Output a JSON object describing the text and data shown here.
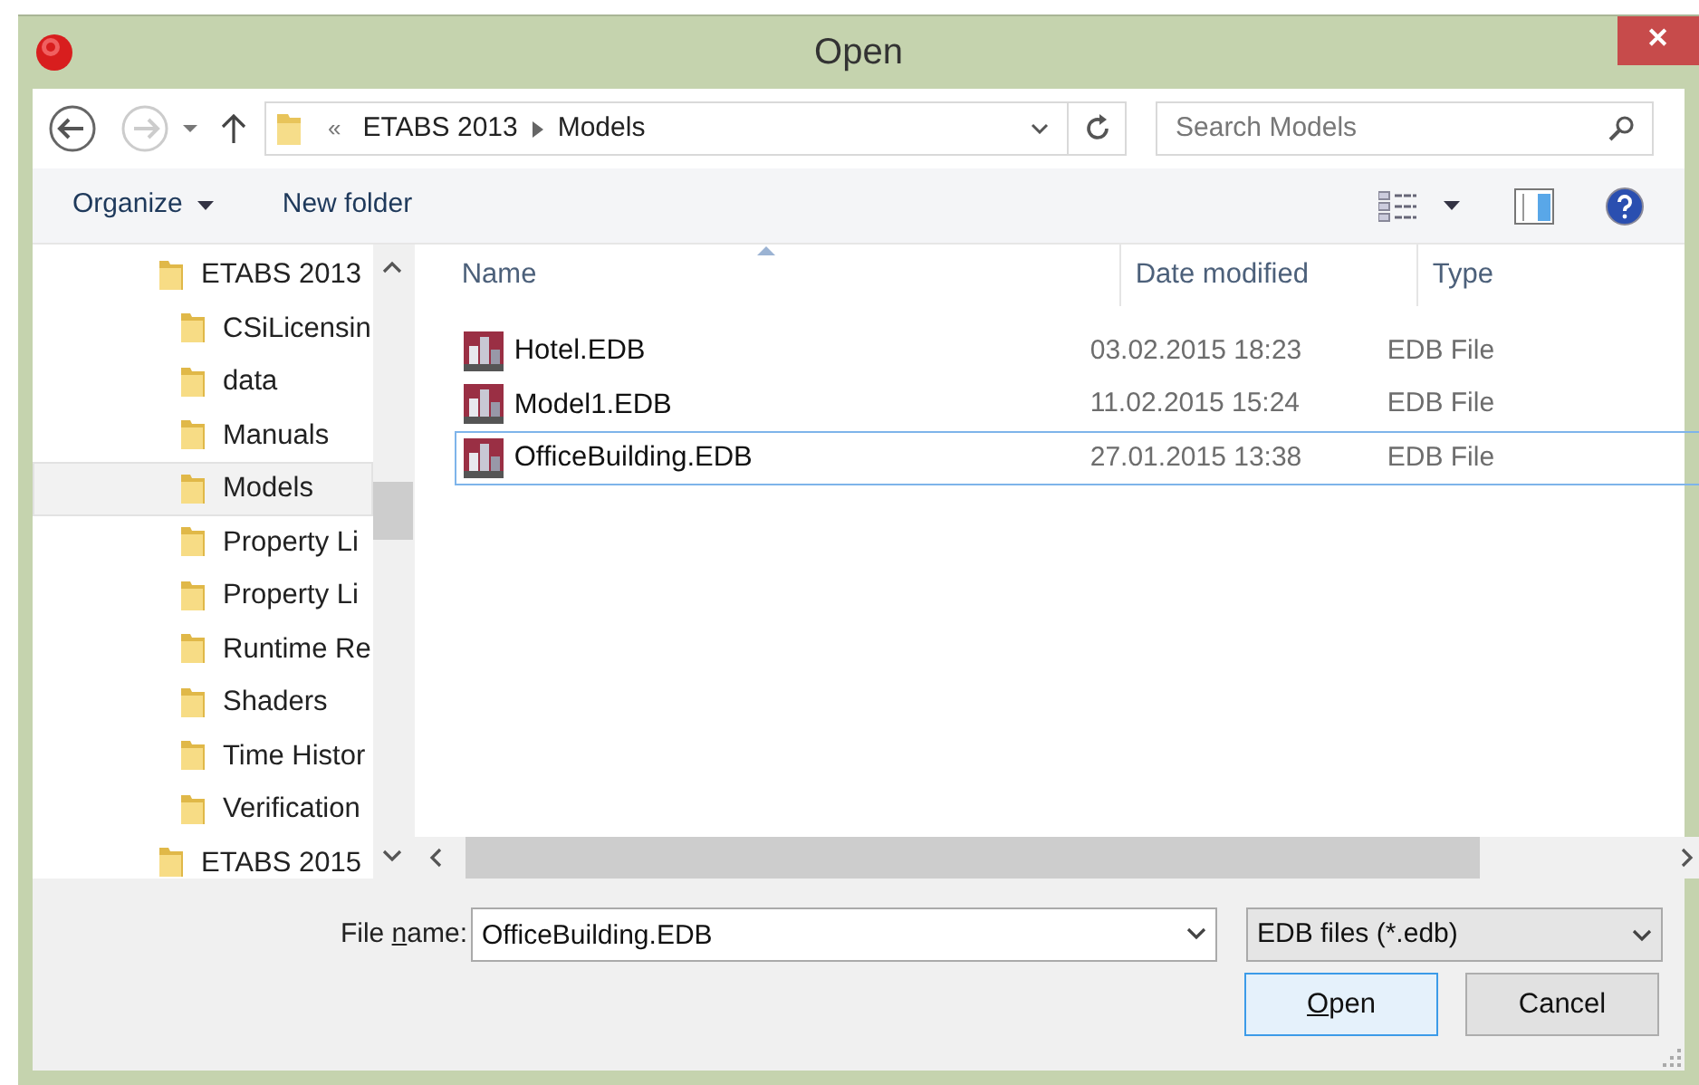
{
  "window": {
    "title": "Open",
    "close": "✕"
  },
  "address_bar": {
    "overflow": "«",
    "path": [
      "ETABS 2013",
      "Models"
    ]
  },
  "search": {
    "placeholder": "Search Models"
  },
  "toolbar": {
    "items": [
      "Organize",
      "New folder"
    ]
  },
  "navigation": {
    "items": [
      {
        "label": "ETABS 2013",
        "selected": false,
        "children": [
          {
            "label": "CSiLicensin",
            "selected": false
          },
          {
            "label": "data",
            "selected": false
          },
          {
            "label": "Manuals",
            "selected": false
          },
          {
            "label": "Models",
            "selected": true
          },
          {
            "label": "Property Li",
            "selected": false
          },
          {
            "label": "Property Li",
            "selected": false
          },
          {
            "label": "Runtime Re",
            "selected": false
          },
          {
            "label": "Shaders",
            "selected": false
          },
          {
            "label": "Time Histor",
            "selected": false
          },
          {
            "label": "Verification",
            "selected": false
          }
        ]
      },
      {
        "label": "ETABS 2015",
        "selected": false
      }
    ]
  },
  "file_list": {
    "columns": [
      "Name",
      "Date modified",
      "Type"
    ],
    "rows": [
      {
        "name": "Hotel.EDB",
        "date": "03.02.2015 18:23",
        "type": "EDB File",
        "selected": false
      },
      {
        "name": "Model1.EDB",
        "date": "11.02.2015 15:24",
        "type": "EDB File",
        "selected": false
      },
      {
        "name": "OfficeBuilding.EDB",
        "date": "27.01.2015 13:38",
        "type": "EDB File",
        "selected": true
      }
    ]
  },
  "file_name": {
    "label": {
      "before": "File ",
      "key": "n",
      "after": "ame:"
    },
    "value": "OfficeBuilding.EDB"
  },
  "file_type": {
    "value": "EDB files (*.edb)"
  },
  "buttons": [
    {
      "label": {
        "key": "O",
        "after": "pen"
      },
      "kind": "default"
    },
    {
      "label": {
        "before": "Cancel"
      },
      "kind": "normal"
    }
  ]
}
